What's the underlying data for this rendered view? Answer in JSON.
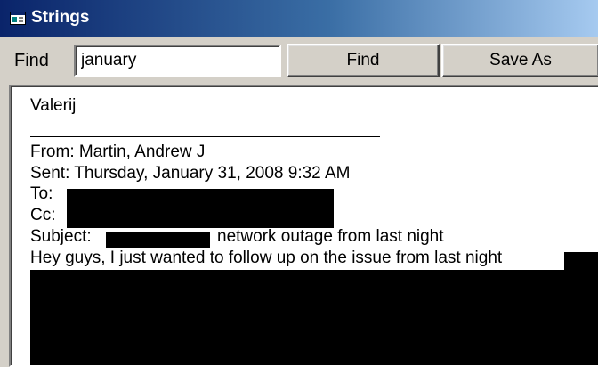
{
  "window": {
    "title": "Strings",
    "icon": "app-window-icon"
  },
  "toolbar": {
    "find_label": "Find",
    "search_value": "january",
    "find_button": "Find",
    "save_as_button": "Save As"
  },
  "content": {
    "lines": [
      "Valerij",
      "From: Martin, Andrew J",
      "Sent: Thursday, January 31, 2008 9:32 AM",
      "To:",
      "Cc:",
      "Subject:",
      "network outage from last night",
      "Hey guys, I just wanted to follow up on the issue from last night"
    ]
  },
  "colors": {
    "window_face": "#d4d0c8",
    "title_gradient_start": "#0a246a",
    "title_gradient_end": "#a6caf0",
    "text_background": "#ffffff",
    "redaction": "#000000"
  }
}
